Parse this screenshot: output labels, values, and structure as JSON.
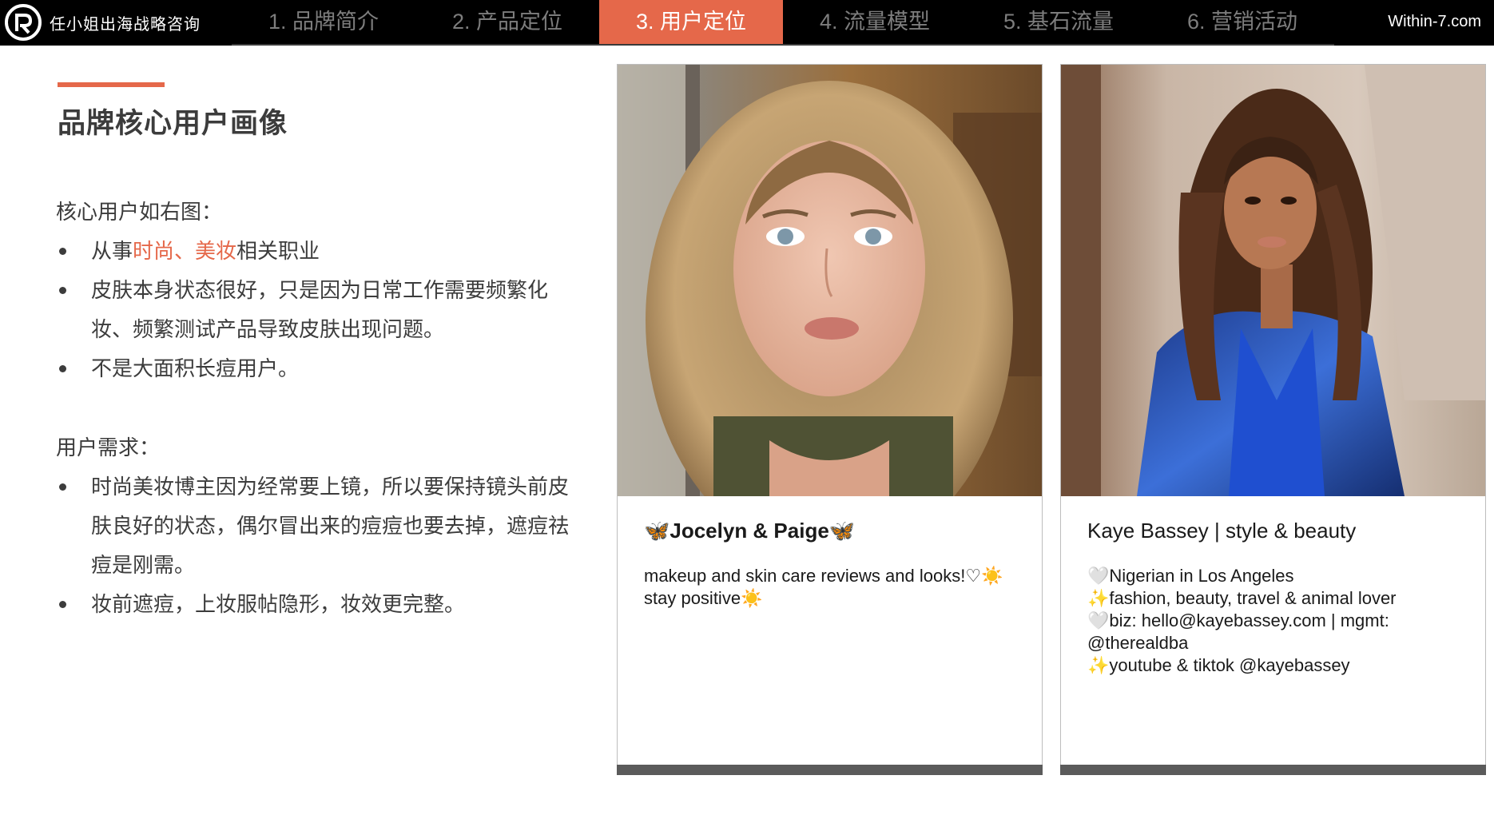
{
  "header": {
    "brand": "任小姐出海战略咨询",
    "site": "Within-7.com",
    "nav": [
      {
        "label": "1. 品牌简介"
      },
      {
        "label": "2. 产品定位"
      },
      {
        "label": "3. 用户定位"
      },
      {
        "label": "4. 流量模型"
      },
      {
        "label": "5. 基石流量"
      },
      {
        "label": "6. 营销活动"
      }
    ],
    "active_index": 2
  },
  "main": {
    "title": "品牌核心用户画像",
    "core_heading": "核心用户如右图：",
    "core_item1_pre": "从事",
    "core_item1_hl": "时尚、美妆",
    "core_item1_post": "相关职业",
    "core_item2": "皮肤本身状态很好，只是因为日常工作需要频繁化妆、频繁测试产品导致皮肤出现问题。",
    "core_item3": "不是大面积长痘用户。",
    "needs_heading": "用户需求：",
    "needs_item1": "时尚美妆博主因为经常要上镜，所以要保持镜头前皮肤良好的状态，偶尔冒出来的痘痘也要去掉，遮痘祛痘是刚需。",
    "needs_item2": "妆前遮痘，上妆服帖隐形，妆效更完整。"
  },
  "cards": [
    {
      "name": "🦋Jocelyn & Paige🦋",
      "bio": [
        "makeup and skin care reviews and looks!♡☀️stay positive☀️"
      ]
    },
    {
      "name": "Kaye Bassey | style & beauty",
      "bio": [
        "🤍Nigerian in Los Angeles",
        "✨fashion, beauty, travel & animal lover",
        "🤍biz: hello@kayebassey.com | mgmt: @therealdba",
        "✨youtube & tiktok @kayebassey"
      ]
    }
  ],
  "colors": {
    "accent": "#e5684a",
    "bar": "#000000",
    "nav_inactive": "#7d7d7d"
  }
}
